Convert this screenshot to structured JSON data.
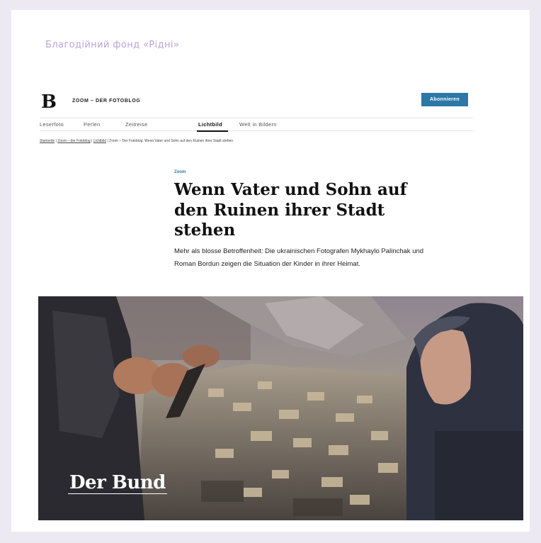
{
  "foundation_title": "Благодійний фонд «Рідні»",
  "header": {
    "logo_letter": "B",
    "blog_name": "ZOOM – DER FOTOBLOG",
    "subscribe_label": "Abonnieren"
  },
  "nav": {
    "items": [
      {
        "label": "Leserfoto"
      },
      {
        "label": "Perlen"
      },
      {
        "label": "Zeitreise"
      },
      {
        "label": "Lichtbild"
      },
      {
        "label": "Welt in Bildern"
      }
    ],
    "active": "Lichtbild"
  },
  "breadcrumb": {
    "items": [
      "Startseite",
      "Zoom – der Fotoblog",
      "Lichtbild",
      "Zoom – Der Fotoblog: Wenn Vater und Sohn auf den Ruinen ihrer Stadt stehen"
    ],
    "separator": " | "
  },
  "article": {
    "category": "Zoom",
    "headline": "Wenn Vater und Sohn auf den Ruinen ihrer Stadt stehen",
    "lead": "Mehr als blosse Betroffenheit: Die ukrainischen Fotografen Mykhaylo Palinchak und Roman Bordun zeigen die Situation der Kinder in ihrer Heimat."
  },
  "photo": {
    "watermark": "Der Bund"
  },
  "colors": {
    "page_bg": "#ece9f3",
    "accent": "#2c77a7",
    "foundation_text": "#b6a6d6"
  }
}
